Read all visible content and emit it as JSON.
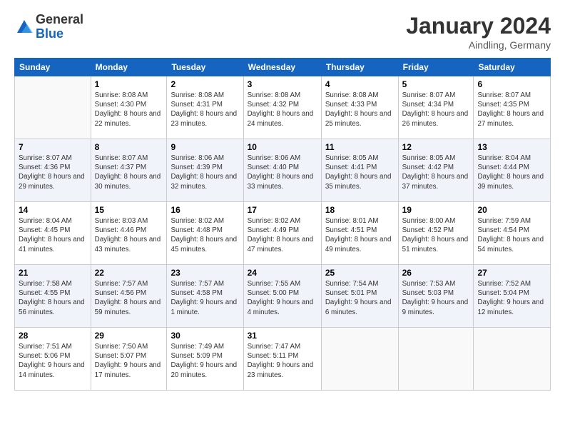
{
  "header": {
    "logo": {
      "general": "General",
      "blue": "Blue"
    },
    "title": "January 2024",
    "location": "Aindling, Germany"
  },
  "calendar": {
    "days": [
      "Sunday",
      "Monday",
      "Tuesday",
      "Wednesday",
      "Thursday",
      "Friday",
      "Saturday"
    ],
    "weeks": [
      [
        {
          "num": "",
          "info": ""
        },
        {
          "num": "1",
          "sunrise": "Sunrise: 8:08 AM",
          "sunset": "Sunset: 4:30 PM",
          "daylight": "Daylight: 8 hours and 22 minutes."
        },
        {
          "num": "2",
          "sunrise": "Sunrise: 8:08 AM",
          "sunset": "Sunset: 4:31 PM",
          "daylight": "Daylight: 8 hours and 23 minutes."
        },
        {
          "num": "3",
          "sunrise": "Sunrise: 8:08 AM",
          "sunset": "Sunset: 4:32 PM",
          "daylight": "Daylight: 8 hours and 24 minutes."
        },
        {
          "num": "4",
          "sunrise": "Sunrise: 8:08 AM",
          "sunset": "Sunset: 4:33 PM",
          "daylight": "Daylight: 8 hours and 25 minutes."
        },
        {
          "num": "5",
          "sunrise": "Sunrise: 8:07 AM",
          "sunset": "Sunset: 4:34 PM",
          "daylight": "Daylight: 8 hours and 26 minutes."
        },
        {
          "num": "6",
          "sunrise": "Sunrise: 8:07 AM",
          "sunset": "Sunset: 4:35 PM",
          "daylight": "Daylight: 8 hours and 27 minutes."
        }
      ],
      [
        {
          "num": "7",
          "sunrise": "Sunrise: 8:07 AM",
          "sunset": "Sunset: 4:36 PM",
          "daylight": "Daylight: 8 hours and 29 minutes."
        },
        {
          "num": "8",
          "sunrise": "Sunrise: 8:07 AM",
          "sunset": "Sunset: 4:37 PM",
          "daylight": "Daylight: 8 hours and 30 minutes."
        },
        {
          "num": "9",
          "sunrise": "Sunrise: 8:06 AM",
          "sunset": "Sunset: 4:39 PM",
          "daylight": "Daylight: 8 hours and 32 minutes."
        },
        {
          "num": "10",
          "sunrise": "Sunrise: 8:06 AM",
          "sunset": "Sunset: 4:40 PM",
          "daylight": "Daylight: 8 hours and 33 minutes."
        },
        {
          "num": "11",
          "sunrise": "Sunrise: 8:05 AM",
          "sunset": "Sunset: 4:41 PM",
          "daylight": "Daylight: 8 hours and 35 minutes."
        },
        {
          "num": "12",
          "sunrise": "Sunrise: 8:05 AM",
          "sunset": "Sunset: 4:42 PM",
          "daylight": "Daylight: 8 hours and 37 minutes."
        },
        {
          "num": "13",
          "sunrise": "Sunrise: 8:04 AM",
          "sunset": "Sunset: 4:44 PM",
          "daylight": "Daylight: 8 hours and 39 minutes."
        }
      ],
      [
        {
          "num": "14",
          "sunrise": "Sunrise: 8:04 AM",
          "sunset": "Sunset: 4:45 PM",
          "daylight": "Daylight: 8 hours and 41 minutes."
        },
        {
          "num": "15",
          "sunrise": "Sunrise: 8:03 AM",
          "sunset": "Sunset: 4:46 PM",
          "daylight": "Daylight: 8 hours and 43 minutes."
        },
        {
          "num": "16",
          "sunrise": "Sunrise: 8:02 AM",
          "sunset": "Sunset: 4:48 PM",
          "daylight": "Daylight: 8 hours and 45 minutes."
        },
        {
          "num": "17",
          "sunrise": "Sunrise: 8:02 AM",
          "sunset": "Sunset: 4:49 PM",
          "daylight": "Daylight: 8 hours and 47 minutes."
        },
        {
          "num": "18",
          "sunrise": "Sunrise: 8:01 AM",
          "sunset": "Sunset: 4:51 PM",
          "daylight": "Daylight: 8 hours and 49 minutes."
        },
        {
          "num": "19",
          "sunrise": "Sunrise: 8:00 AM",
          "sunset": "Sunset: 4:52 PM",
          "daylight": "Daylight: 8 hours and 51 minutes."
        },
        {
          "num": "20",
          "sunrise": "Sunrise: 7:59 AM",
          "sunset": "Sunset: 4:54 PM",
          "daylight": "Daylight: 8 hours and 54 minutes."
        }
      ],
      [
        {
          "num": "21",
          "sunrise": "Sunrise: 7:58 AM",
          "sunset": "Sunset: 4:55 PM",
          "daylight": "Daylight: 8 hours and 56 minutes."
        },
        {
          "num": "22",
          "sunrise": "Sunrise: 7:57 AM",
          "sunset": "Sunset: 4:56 PM",
          "daylight": "Daylight: 8 hours and 59 minutes."
        },
        {
          "num": "23",
          "sunrise": "Sunrise: 7:57 AM",
          "sunset": "Sunset: 4:58 PM",
          "daylight": "Daylight: 9 hours and 1 minute."
        },
        {
          "num": "24",
          "sunrise": "Sunrise: 7:55 AM",
          "sunset": "Sunset: 5:00 PM",
          "daylight": "Daylight: 9 hours and 4 minutes."
        },
        {
          "num": "25",
          "sunrise": "Sunrise: 7:54 AM",
          "sunset": "Sunset: 5:01 PM",
          "daylight": "Daylight: 9 hours and 6 minutes."
        },
        {
          "num": "26",
          "sunrise": "Sunrise: 7:53 AM",
          "sunset": "Sunset: 5:03 PM",
          "daylight": "Daylight: 9 hours and 9 minutes."
        },
        {
          "num": "27",
          "sunrise": "Sunrise: 7:52 AM",
          "sunset": "Sunset: 5:04 PM",
          "daylight": "Daylight: 9 hours and 12 minutes."
        }
      ],
      [
        {
          "num": "28",
          "sunrise": "Sunrise: 7:51 AM",
          "sunset": "Sunset: 5:06 PM",
          "daylight": "Daylight: 9 hours and 14 minutes."
        },
        {
          "num": "29",
          "sunrise": "Sunrise: 7:50 AM",
          "sunset": "Sunset: 5:07 PM",
          "daylight": "Daylight: 9 hours and 17 minutes."
        },
        {
          "num": "30",
          "sunrise": "Sunrise: 7:49 AM",
          "sunset": "Sunset: 5:09 PM",
          "daylight": "Daylight: 9 hours and 20 minutes."
        },
        {
          "num": "31",
          "sunrise": "Sunrise: 7:47 AM",
          "sunset": "Sunset: 5:11 PM",
          "daylight": "Daylight: 9 hours and 23 minutes."
        },
        {
          "num": "",
          "info": ""
        },
        {
          "num": "",
          "info": ""
        },
        {
          "num": "",
          "info": ""
        }
      ]
    ]
  }
}
